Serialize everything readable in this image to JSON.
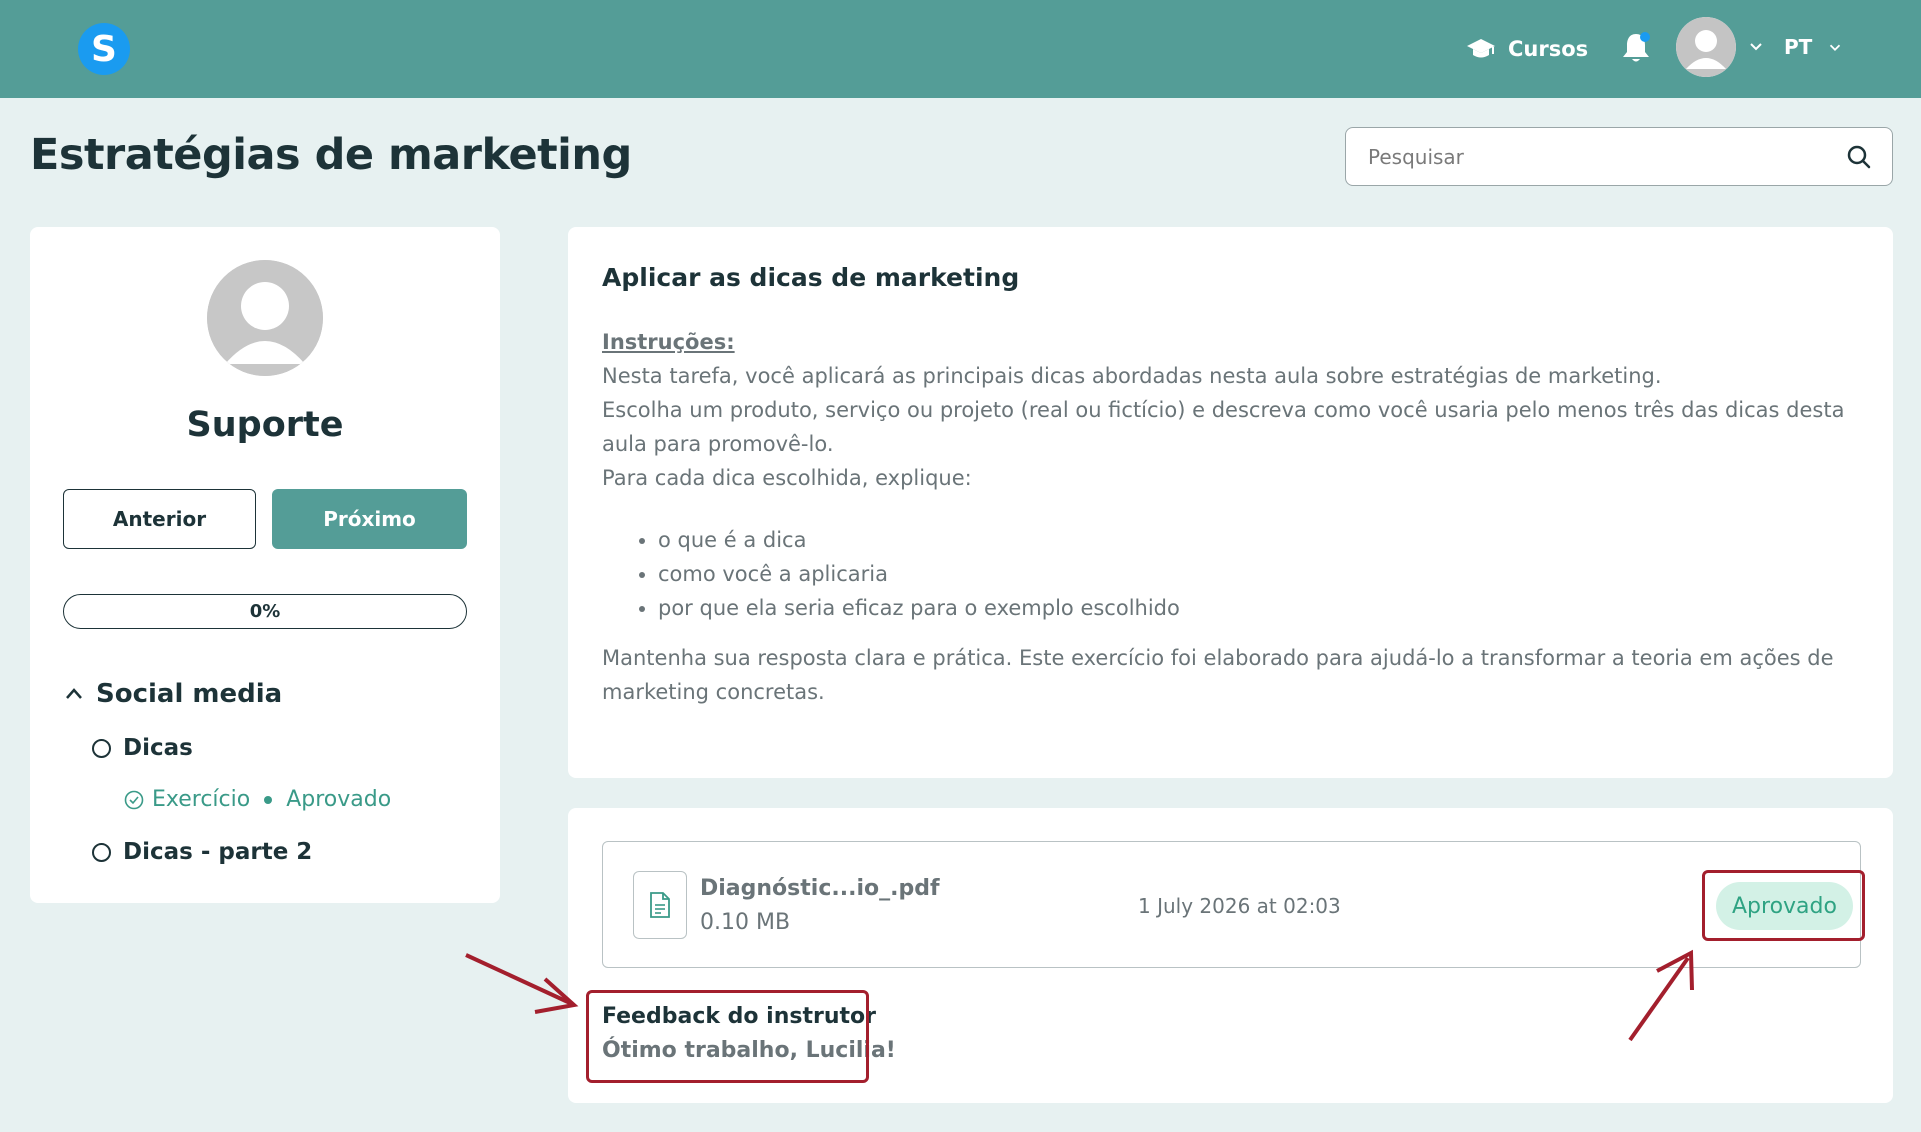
{
  "header": {
    "logo_letter": "S",
    "courses_label": "Cursos",
    "lang_label": "PT"
  },
  "page": {
    "title": "Estratégias de marketing"
  },
  "search": {
    "placeholder": "Pesquisar"
  },
  "sidebar": {
    "name": "Suporte",
    "prev_label": "Anterior",
    "next_label": "Próximo",
    "progress_label": "0%",
    "progress_value": 0,
    "section_title": "Social media",
    "lessons": [
      {
        "label": "Dicas"
      },
      {
        "label": "Dicas - parte 2"
      }
    ],
    "exercise": {
      "label": "Exercício",
      "status": "Aprovado"
    }
  },
  "assignment": {
    "title": "Aplicar as dicas de marketing",
    "instructions_label": "Instruções:",
    "lines": [
      "Nesta tarefa, você aplicará as principais dicas abordadas nesta aula sobre estratégias de marketing.",
      "Escolha um produto, serviço ou projeto (real ou fictício) e descreva como você usaria pelo menos três das dicas desta aula para promovê-lo.",
      "Para cada dica escolhida, explique:"
    ],
    "bullets": [
      "o que é a dica",
      "como você a aplicaria",
      "por que ela seria eficaz para o exemplo escolhido"
    ],
    "closing": "Mantenha sua resposta clara e prática. Este exercício foi elaborado para ajudá-lo a transformar a teoria em ações de marketing concretas."
  },
  "submission": {
    "file_name": "Diagnóstic...io_.pdf",
    "file_size": "0.10 MB",
    "date": "1 July 2026 at 02:03",
    "status": "Aprovado"
  },
  "feedback": {
    "title": "Feedback do instrutor",
    "text": "Ótimo trabalho, Lucilia!"
  },
  "colors": {
    "header": "#549d97",
    "accent": "#549d97",
    "approved_text": "#2fa383",
    "approved_bg": "#d3f1e6",
    "annotation": "#a31f2d"
  }
}
